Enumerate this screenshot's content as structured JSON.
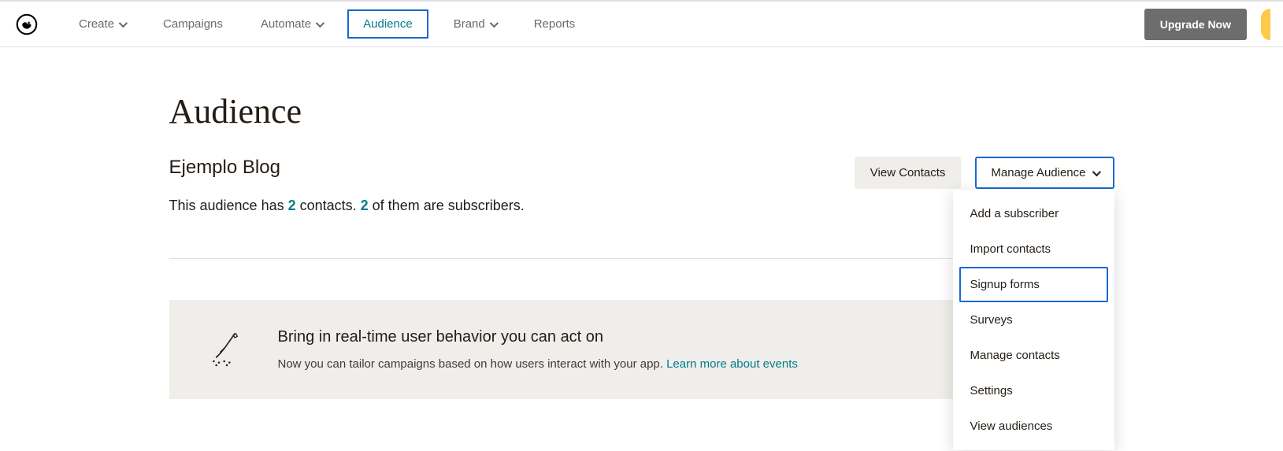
{
  "nav": {
    "items": [
      {
        "label": "Create",
        "hasChevron": true
      },
      {
        "label": "Campaigns",
        "hasChevron": false
      },
      {
        "label": "Automate",
        "hasChevron": true
      },
      {
        "label": "Audience",
        "hasChevron": false,
        "active": true
      },
      {
        "label": "Brand",
        "hasChevron": true
      },
      {
        "label": "Reports",
        "hasChevron": false
      }
    ],
    "upgrade_label": "Upgrade Now"
  },
  "page": {
    "title": "Audience",
    "audience_name": "Ejemplo Blog",
    "stats": {
      "prefix": "This audience has ",
      "contacts": "2",
      "mid": " contacts. ",
      "subscribers": "2",
      "suffix": " of them are subscribers."
    },
    "view_contacts_label": "View Contacts",
    "manage_audience_label": "Manage Audience"
  },
  "dropdown": {
    "items": [
      {
        "label": "Add a subscriber"
      },
      {
        "label": "Import contacts"
      },
      {
        "label": "Signup forms",
        "highlight": true
      },
      {
        "label": "Surveys"
      },
      {
        "label": "Manage contacts"
      },
      {
        "label": "Settings"
      },
      {
        "label": "View audiences"
      }
    ]
  },
  "promo": {
    "title": "Bring in real-time user behavior you can act on",
    "desc": "Now you can tailor campaigns based on how users interact with your app. ",
    "link": "Learn more about events"
  }
}
